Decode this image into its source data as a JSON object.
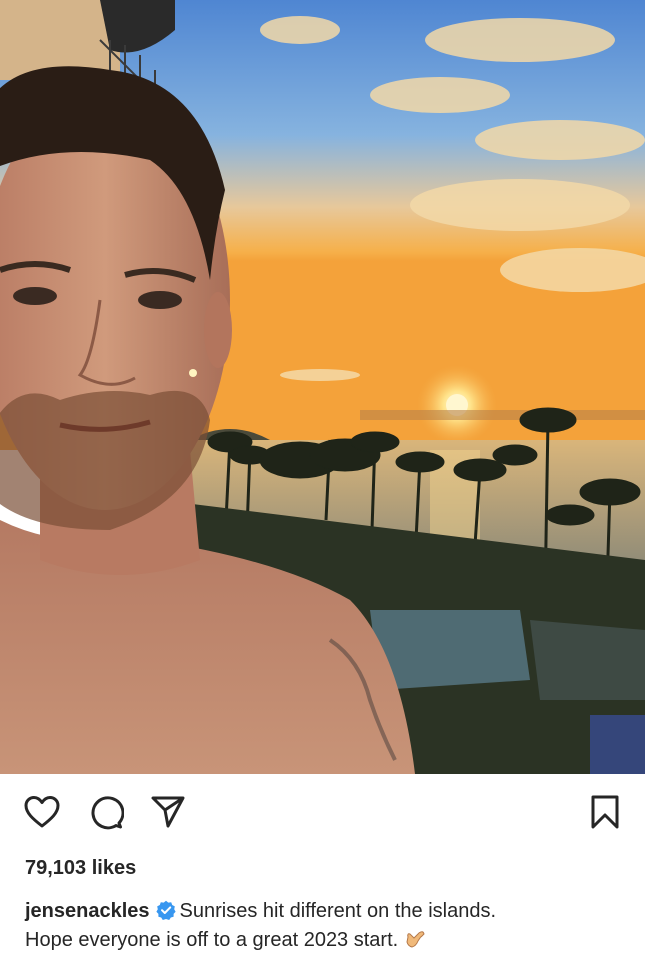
{
  "post": {
    "image": {
      "description_icon": "sunrise-selfie-photo",
      "colors": {
        "sky_top": "#5b8fd6",
        "horizon": "#f6b04a",
        "sea": "#c9a86a",
        "skin": "#c98f72"
      }
    },
    "actions": {
      "like_icon": "heart-icon",
      "comment_icon": "comment-icon",
      "share_icon": "send-icon",
      "save_icon": "bookmark-icon"
    },
    "likes_text": "79,103 likes",
    "caption": {
      "username": "jensenackles",
      "verified": true,
      "text_line1": "Sunrises hit different on the islands.",
      "text_line2": "Hope everyone is off to a great 2023 start.",
      "emoji": "🤙"
    }
  }
}
